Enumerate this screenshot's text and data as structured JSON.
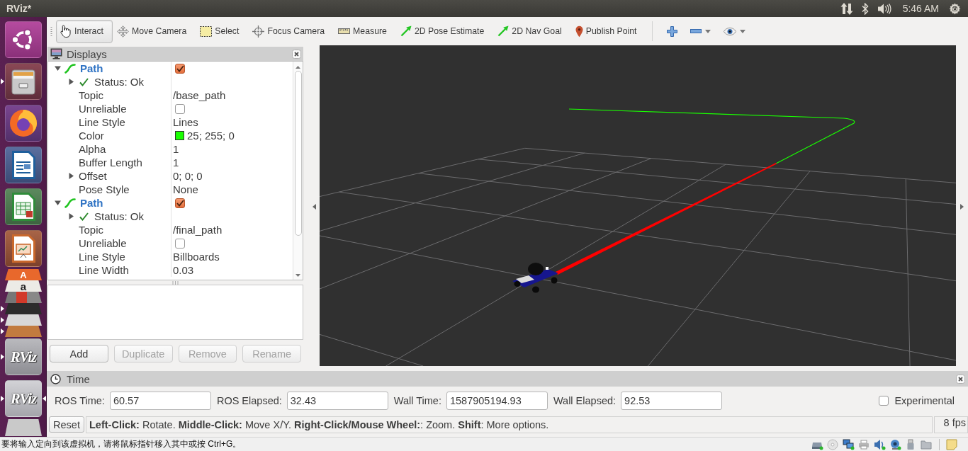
{
  "top_bar": {
    "title": "RViz*",
    "clock": "5:46 AM"
  },
  "launcher": [
    {
      "kind": "ubuntu",
      "running": false,
      "focused": false
    },
    {
      "kind": "files",
      "running": true,
      "focused": false
    },
    {
      "kind": "firefox",
      "running": false,
      "focused": false
    },
    {
      "kind": "writer",
      "running": false,
      "focused": false
    },
    {
      "kind": "calc",
      "running": false,
      "focused": false
    },
    {
      "kind": "impress",
      "running": false,
      "focused": false
    },
    {
      "kind": "software",
      "glyph": "A",
      "running": false,
      "focused": false
    },
    {
      "kind": "amazon",
      "glyph": "a",
      "running": false,
      "focused": false
    },
    {
      "kind": "draw",
      "running": false,
      "focused": false
    },
    {
      "kind": "terminal",
      "running": true,
      "focused": false
    },
    {
      "kind": "editor",
      "running": true,
      "focused": false
    },
    {
      "kind": "package",
      "running": true,
      "focused": false
    },
    {
      "kind": "rviz",
      "label": "RViz",
      "running": true,
      "focused": false
    },
    {
      "kind": "rviz",
      "label": "RViz",
      "running": true,
      "focused": true
    },
    {
      "kind": "drive",
      "running": false,
      "focused": false
    }
  ],
  "toolbar": {
    "tools": [
      {
        "kind": "interact",
        "label": "Interact",
        "selected": true
      },
      {
        "kind": "move_camera",
        "label": "Move Camera",
        "selected": false
      },
      {
        "kind": "select",
        "label": "Select",
        "selected": false
      },
      {
        "kind": "focus_camera",
        "label": "Focus Camera",
        "selected": false
      },
      {
        "kind": "measure",
        "label": "Measure",
        "selected": false
      },
      {
        "kind": "pose_estimate",
        "label": "2D Pose Estimate",
        "selected": false
      },
      {
        "kind": "nav_goal",
        "label": "2D Nav Goal",
        "selected": false
      },
      {
        "kind": "publish_point",
        "label": "Publish Point",
        "selected": false
      }
    ],
    "view_buttons": [
      {
        "kind": "add",
        "menu": false
      },
      {
        "kind": "remove",
        "menu": true
      },
      {
        "kind": "view",
        "menu": true
      }
    ]
  },
  "displays": {
    "title": "Displays",
    "items": [
      {
        "kind": "path",
        "name": "Path",
        "checked": true,
        "expanded": true,
        "children": [
          {
            "kind": "status",
            "label": "Status: Ok",
            "expanded": false
          },
          {
            "kind": "text",
            "label": "Topic",
            "value": "/base_path"
          },
          {
            "kind": "checkbox",
            "label": "Unreliable",
            "checked": false
          },
          {
            "kind": "text",
            "label": "Line Style",
            "value": "Lines"
          },
          {
            "kind": "color",
            "label": "Color",
            "value": "25; 255; 0",
            "color": "#19ff00"
          },
          {
            "kind": "text",
            "label": "Alpha",
            "value": "1"
          },
          {
            "kind": "text",
            "label": "Buffer Length",
            "value": "1"
          },
          {
            "kind": "group",
            "label": "Offset",
            "value": "0; 0; 0",
            "expanded": false
          },
          {
            "kind": "text",
            "label": "Pose Style",
            "value": "None"
          }
        ]
      },
      {
        "kind": "path",
        "name": "Path",
        "checked": true,
        "expanded": true,
        "children": [
          {
            "kind": "status",
            "label": "Status: Ok",
            "expanded": false
          },
          {
            "kind": "text",
            "label": "Topic",
            "value": "/final_path"
          },
          {
            "kind": "checkbox",
            "label": "Unreliable",
            "checked": false
          },
          {
            "kind": "text",
            "label": "Line Style",
            "value": "Billboards"
          },
          {
            "kind": "text",
            "label": "Line Width",
            "value": "0.03"
          }
        ]
      }
    ],
    "buttons": [
      {
        "label": "Add",
        "disabled": false
      },
      {
        "label": "Duplicate",
        "disabled": true
      },
      {
        "label": "Remove",
        "disabled": true
      },
      {
        "label": "Rename",
        "disabled": true
      }
    ]
  },
  "time_panel": {
    "title": "Time",
    "fields": [
      {
        "label": "ROS Time:",
        "value": "60.57"
      },
      {
        "label": "ROS Elapsed:",
        "value": "32.43"
      },
      {
        "label": "Wall Time:",
        "value": "1587905194.93"
      },
      {
        "label": "Wall Elapsed:",
        "value": "92.53"
      }
    ],
    "experimental": {
      "label": "Experimental",
      "checked": false
    }
  },
  "status_bar": {
    "reset": "Reset",
    "message": "**Left-Click:** Rotate. **Middle-Click:** Move X/Y. **Right-Click/Mouse Wheel:**: Zoom. **Shift**: More options.",
    "fps": "8 fps"
  },
  "vm_bar": {
    "message": "要将输入定向到该虚拟机，请将鼠标指针移入其中或按 Ctrl+G。",
    "devices": [
      {
        "kind": "disk",
        "active": true
      },
      {
        "kind": "optical",
        "active": false
      },
      {
        "kind": "network",
        "active": true
      },
      {
        "kind": "printer",
        "active": false
      },
      {
        "kind": "audio",
        "active": true
      },
      {
        "kind": "camera",
        "active": true
      },
      {
        "kind": "usb",
        "active": false
      },
      {
        "kind": "shared_folder",
        "active": false
      },
      {
        "kind": "notes",
        "active": false
      }
    ]
  }
}
